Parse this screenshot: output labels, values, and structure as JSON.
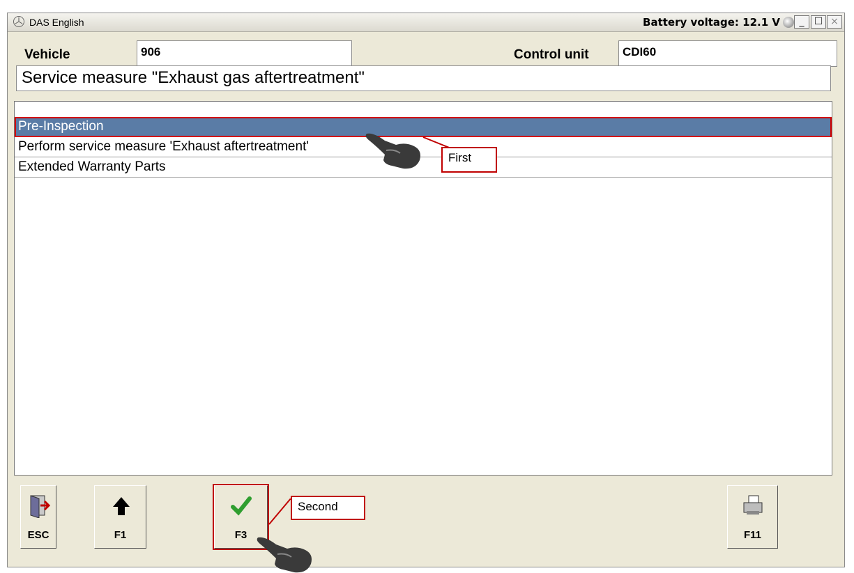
{
  "window": {
    "title": "DAS English",
    "battery_label": "Battery voltage: 12.1 V",
    "min_glyph": "_",
    "max_glyph": "☐",
    "close_glyph": "×"
  },
  "header": {
    "vehicle_label": "Vehicle",
    "vehicle_value": "906",
    "control_unit_label": "Control unit",
    "control_unit_value": "CDI60"
  },
  "page_title": "Service measure \"Exhaust gas aftertreatment\"",
  "list": {
    "items": [
      {
        "label": "Pre-Inspection",
        "selected": true
      },
      {
        "label": "Perform service measure 'Exhaust aftertreatment'",
        "selected": false
      },
      {
        "label": "Extended Warranty Parts",
        "selected": false
      }
    ]
  },
  "toolbar": {
    "esc_label": "ESC",
    "f1_label": "F1",
    "f3_label": "F3",
    "f11_label": "F11"
  },
  "annotations": {
    "first": "First",
    "second": "Second"
  },
  "colors": {
    "selection": "#5a7ca6",
    "annotation_red": "#c00000",
    "check_green": "#2f9e2f"
  },
  "icons": [
    "exit-door-icon",
    "up-arrow-icon",
    "checkmark-icon",
    "printer-icon",
    "pointing-hand-icon"
  ]
}
